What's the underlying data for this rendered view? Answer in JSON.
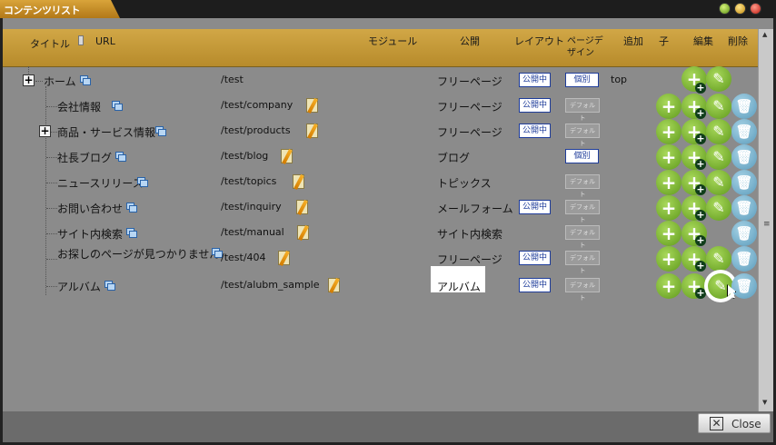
{
  "window": {
    "title": "コンテンツリスト",
    "close_label": "Close"
  },
  "header": {
    "title_col": "タイトル",
    "url_col": "URL",
    "module_col": "モジュール",
    "public_col": "公開",
    "layout_col": "レイアウト",
    "pagedesign_col": "ページデザイン",
    "add_col": "追加",
    "child_col": "子",
    "edit_col": "編集",
    "delete_col": "削除"
  },
  "rows": [
    {
      "title": "ホーム",
      "url": "/test",
      "module": "フリーページ",
      "layout": "公開中",
      "design": "個別",
      "design_on": true,
      "add": "top",
      "level": 0,
      "expander": true,
      "pencil": false,
      "add_btn": false,
      "edit": true,
      "del": false
    },
    {
      "title": "会社情報",
      "url": "/test/company",
      "module": "フリーページ",
      "layout": "公開中",
      "design": "デフォルト",
      "design_on": false,
      "add": "",
      "level": 1,
      "expander": false,
      "pencil": true,
      "add_btn": true,
      "edit": true,
      "del": true
    },
    {
      "title": "商品・サービス情報",
      "url": "/test/products",
      "module": "フリーページ",
      "layout": "公開中",
      "design": "デフォルト",
      "design_on": false,
      "add": "",
      "level": 1,
      "expander": true,
      "pencil": true,
      "add_btn": true,
      "edit": true,
      "del": true
    },
    {
      "title": "社長ブログ",
      "url": "/test/blog",
      "module": "ブログ",
      "layout": "",
      "design": "個別",
      "design_on": true,
      "add": "",
      "level": 1,
      "expander": false,
      "pencil": true,
      "add_btn": true,
      "edit": true,
      "del": true
    },
    {
      "title": "ニュースリリース",
      "url": "/test/topics",
      "module": "トピックス",
      "layout": "",
      "design": "デフォルト",
      "design_on": false,
      "add": "",
      "level": 1,
      "expander": false,
      "pencil": true,
      "add_btn": true,
      "edit": true,
      "del": true
    },
    {
      "title": "お問い合わせ",
      "url": "/test/inquiry",
      "module": "メールフォーム",
      "layout": "公開中",
      "design": "デフォルト",
      "design_on": false,
      "add": "",
      "level": 1,
      "expander": false,
      "pencil": true,
      "add_btn": true,
      "edit": true,
      "del": true
    },
    {
      "title": "サイト内検索",
      "url": "/test/manual",
      "module": "サイト内検索",
      "layout": "",
      "design": "デフォルト",
      "design_on": false,
      "add": "",
      "level": 1,
      "expander": false,
      "pencil": true,
      "add_btn": true,
      "edit": false,
      "del": true
    },
    {
      "title": "お探しのページが見つかりません",
      "url": "/test/404",
      "module": "フリーページ",
      "layout": "公開中",
      "design": "デフォルト",
      "design_on": false,
      "add": "",
      "level": 1,
      "expander": false,
      "pencil": true,
      "add_btn": true,
      "edit": true,
      "del": true
    },
    {
      "title": "アルバム",
      "url": "/test/alubm_sample",
      "module": "アルバム",
      "layout": "公開中",
      "design": "デフォルト",
      "design_on": false,
      "add": "",
      "level": 1,
      "expander": false,
      "pencil": true,
      "add_btn": true,
      "edit": true,
      "del": true,
      "highlight_module": true,
      "highlight_edit": true
    }
  ],
  "icons": {
    "copy": "copy-icon",
    "pencil": "pencil-icon",
    "add": "add-icon",
    "edit": "edit-icon",
    "delete": "trash-icon"
  }
}
